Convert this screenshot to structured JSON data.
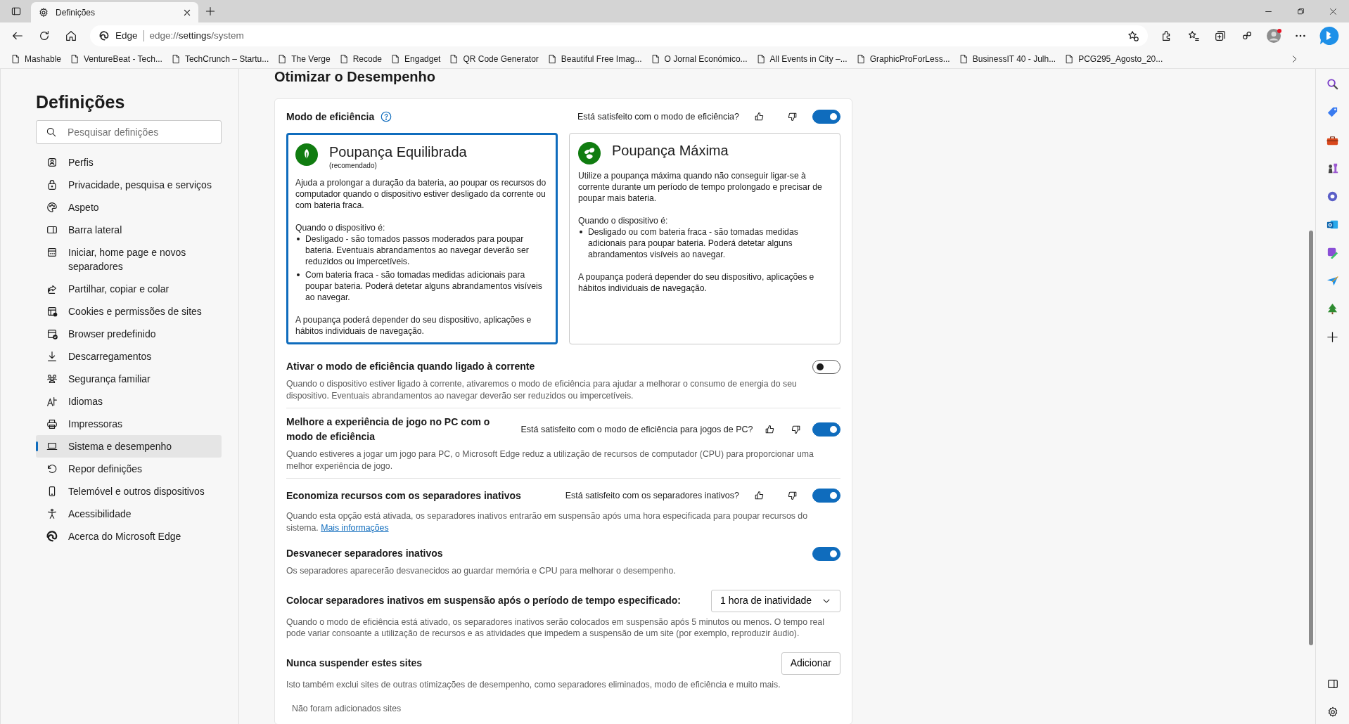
{
  "browser": {
    "tab_title": "Definições",
    "address_label": "Edge",
    "url_scheme": "edge://",
    "url_host": "settings",
    "url_path": "/system",
    "bookmarks": [
      "Mashable",
      "VentureBeat - Tech...",
      "TechCrunch – Startu...",
      "The Verge",
      "Recode",
      "Engadget",
      "QR Code Generator",
      "Beautiful Free Imag...",
      "O Jornal Económico...",
      "All Events in City –...",
      "GraphicProForLess...",
      "BusinessIT 40 - Julh...",
      "PCG295_Agosto_20..."
    ]
  },
  "sidebar": {
    "title": "Definições",
    "search": {
      "placeholder": "Pesquisar definições"
    },
    "items": [
      {
        "label": "Perfis",
        "selected": false
      },
      {
        "label": "Privacidade, pesquisa e serviços",
        "selected": false
      },
      {
        "label": "Aspeto",
        "selected": false
      },
      {
        "label": "Barra lateral",
        "selected": false
      },
      {
        "label": "Iniciar, home page e novos separadores",
        "selected": false
      },
      {
        "label": "Partilhar, copiar e colar",
        "selected": false
      },
      {
        "label": "Cookies e permissões de sites",
        "selected": false
      },
      {
        "label": "Browser predefinido",
        "selected": false
      },
      {
        "label": "Descarregamentos",
        "selected": false
      },
      {
        "label": "Segurança familiar",
        "selected": false
      },
      {
        "label": "Idiomas",
        "selected": false
      },
      {
        "label": "Impressoras",
        "selected": false
      },
      {
        "label": "Sistema e desempenho",
        "selected": true
      },
      {
        "label": "Repor definições",
        "selected": false
      },
      {
        "label": "Telemóvel e outros dispositivos",
        "selected": false
      },
      {
        "label": "Acessibilidade",
        "selected": false
      },
      {
        "label": "Acerca do Microsoft Edge",
        "selected": false
      }
    ]
  },
  "main": {
    "heading": "Otimizar o Desempenho",
    "efficiency": {
      "title": "Modo de eficiência",
      "feedback_question": "Está satisfeito com o modo de eficiência?",
      "on": true
    },
    "modes": [
      {
        "title": "Poupança Equilibrada",
        "subtitle": "(recomendado)",
        "description": "Ajuda a prolongar a duração da bateria, ao poupar os recursos do computador quando o dispositivo estiver desligado da corrente ou com bateria fraca.",
        "device_label": "Quando o dispositivo é:",
        "bullets": [
          "Desligado - são tomados passos moderados para poupar bateria. Eventuais abrandamentos ao navegar deverão ser reduzidos ou impercetíveis.",
          "Com bateria fraca - são tomadas medidas adicionais para poupar bateria. Poderá detetar alguns abrandamentos visíveis ao navegar."
        ],
        "note": "A poupança poderá depender do seu dispositivo, aplicações e hábitos individuais de navegação.",
        "selected": true
      },
      {
        "title": "Poupança Máxima",
        "description": "Utilize a poupança máxima quando não conseguir ligar-se à corrente durante um período de tempo prolongado e precisar de poupar mais bateria.",
        "device_label": "Quando o dispositivo é:",
        "bullets": [
          "Desligado ou com bateria fraca - são tomadas medidas adicionais para poupar bateria. Poderá detetar alguns abrandamentos visíveis ao navegar."
        ],
        "note": "A poupança poderá depender do seu dispositivo, aplicações e hábitos individuais de navegação.",
        "selected": false
      }
    ],
    "settings": [
      {
        "kind": "toggle",
        "title": "Ativar o modo de eficiência quando ligado à corrente",
        "description": "Quando o dispositivo estiver ligado à corrente, ativaremos o modo de eficiência para ajudar a melhorar o consumo de energia do seu dispositivo. Eventuais abrandamentos ao navegar deverão ser reduzidos ou impercetíveis.",
        "on": false,
        "divider": true
      },
      {
        "kind": "toggle",
        "title": "Melhore a experiência de jogo no PC com o modo de eficiência",
        "feedback_question": "Está satisfeito com o modo de eficiência para jogos de PC?",
        "description": "Quando estiveres a jogar um jogo para PC, o Microsoft Edge reduz a utilização de recursos de computador (CPU) para proporcionar uma melhor experiência de jogo.",
        "on": true,
        "divider": true
      },
      {
        "kind": "toggle",
        "title": "Economiza recursos com os separadores inativos",
        "feedback_question": "Está satisfeito com os separadores inativos?",
        "description": "Quando esta opção está ativada, os separadores inativos entrarão em suspensão após uma hora especificada para poupar recursos do sistema.",
        "link": "Mais informações",
        "on": true
      },
      {
        "kind": "toggle",
        "title": "Desvanecer separadores inativos",
        "description": "Os separadores aparecerão desvanecidos ao guardar memória e CPU para melhorar o desempenho.",
        "on": true
      },
      {
        "kind": "dropdown",
        "title": "Colocar separadores inativos em suspensão após o período de tempo especificado:",
        "value": "1 hora de inatividade",
        "description": "Quando o modo de eficiência está ativado, os separadores inativos serão colocados em suspensão após 5 minutos ou menos. O tempo real pode variar consoante a utilização de recursos e as atividades que impedem a suspensão de um site (por exemplo, reproduzir áudio)."
      },
      {
        "kind": "button",
        "title": "Nunca suspender estes sites",
        "button": "Adicionar",
        "description": "Isto também exclui sites de outras otimizações de desempenho, como separadores eliminados, modo de eficiência e muito mais.",
        "empty_text": "Não foram adicionados sites"
      }
    ]
  }
}
